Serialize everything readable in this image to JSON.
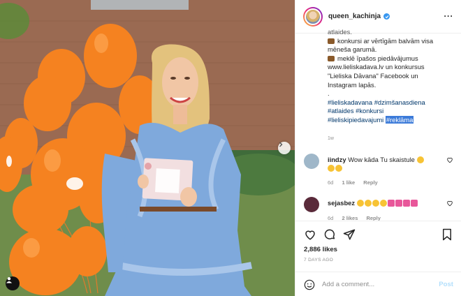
{
  "header": {
    "username": "queen_kachinja",
    "more_label": "···"
  },
  "caption": {
    "line0": "atlaides.",
    "line1": "konkursi ar vērtīgām balvām visa",
    "line2": "mēneša garumā.",
    "line3": "meklē īpašos piedāvājumus",
    "line4": "www.lieliskadava.lv un konkursus",
    "line5": "\"Lieliska Dāvana\" Facebook un",
    "line6": "Instagram lapās.",
    "line7": ".",
    "tags": [
      "#lieliskadavana",
      "#dzimšanasdiena",
      "#atlaides",
      "#konkursi",
      "#lieliskipiedavajumi",
      "#reklāma"
    ],
    "time": "1w"
  },
  "comments": [
    {
      "user": "iindzy",
      "text": "Wow kāda Tu skaistule",
      "age": "6d",
      "likes": "1 like",
      "reply": "Reply",
      "avatar_color": "#9fb7c9"
    },
    {
      "user": "sejasbez",
      "text": "",
      "age": "6d",
      "likes": "2 likes",
      "reply": "Reply",
      "avatar_color": "#5a2a3a"
    }
  ],
  "stats": {
    "likes": "2,886 likes",
    "date": "7 DAYS AGO"
  },
  "composer": {
    "placeholder": "Add a comment...",
    "post_label": "Post"
  },
  "icons": {
    "like": "heart-icon",
    "comment": "comment-icon",
    "share": "paper-plane-icon",
    "save": "bookmark-icon",
    "emoji": "smiley-icon",
    "verified": "verified-badge-icon"
  },
  "colors": {
    "link": "#00376b",
    "muted": "#8e8e8e",
    "highlight": "#3c7bd9",
    "balloon": "#f58220",
    "dress": "#7fa9dc",
    "verified": "#3897f0"
  }
}
